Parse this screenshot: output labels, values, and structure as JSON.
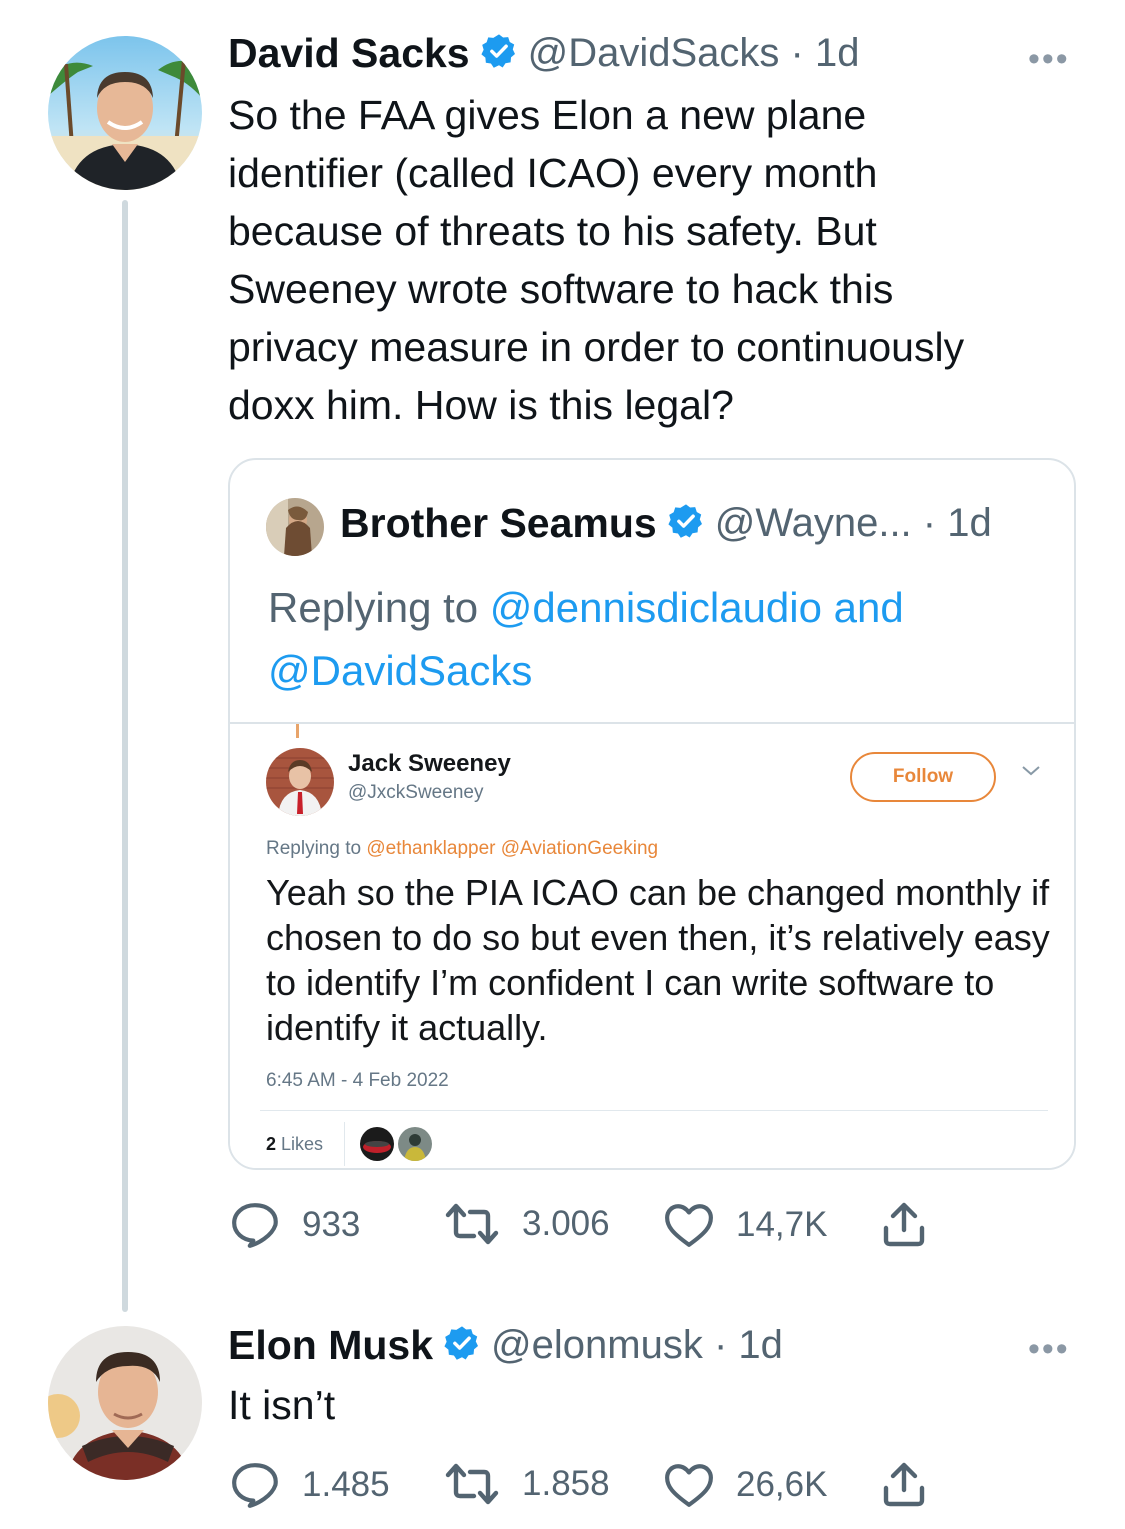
{
  "tweet1": {
    "name": "David Sacks",
    "handle": "@DavidSacks",
    "time": "1d",
    "more": "•••",
    "text_lines": [
      "So the FAA gives Elon a new plane",
      "identifier (called ICAO) every month",
      "because of threats to his safety. But",
      "Sweeney wrote software to hack this",
      "privacy measure in order to continuously",
      "doxx him. How is this legal?"
    ],
    "quote": {
      "name": "Brother Seamus",
      "handle": "@Wayne...",
      "time": "1d",
      "replying_prefix": "Replying to ",
      "replying_link1": "@dennisdiclaudio and",
      "replying_link2": "@DavidSacks",
      "embedded": {
        "name": "Jack Sweeney",
        "handle": "@JxckSweeney",
        "follow_label": "Follow",
        "replying_prefix": "Replying to ",
        "replying_links": "@ethanklapper @AviationGeeking",
        "text": "Yeah so the PIA ICAO can be changed monthly if chosen to do so but even then, it’s relatively easy to identify I’m confident I can write software to identify it actually.",
        "timestamp": "6:45 AM - 4 Feb 2022",
        "likes_count": "2",
        "likes_label": "Likes"
      }
    },
    "stats": {
      "replies": "933",
      "retweets": "3.006",
      "likes": "14,7K"
    }
  },
  "tweet2": {
    "name": "Elon Musk",
    "handle": "@elonmusk",
    "time": "1d",
    "more": "•••",
    "text": "It isn’t",
    "stats": {
      "replies": "1.485",
      "retweets": "1.858",
      "likes": "26,6K"
    }
  },
  "colors": {
    "link": "#1d9bf0",
    "verified": "#1d9bf0",
    "muted": "#536471",
    "follow": "#e8873a"
  }
}
